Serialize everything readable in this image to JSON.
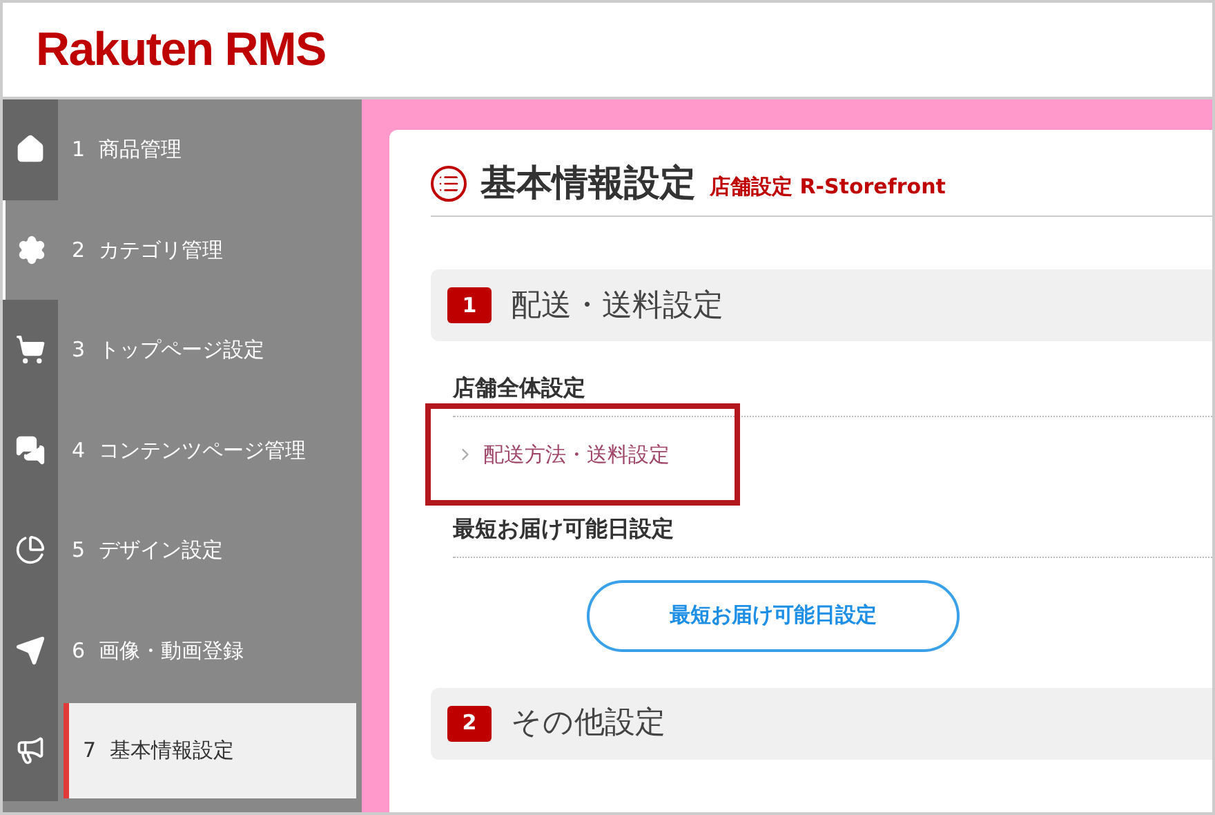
{
  "header": {
    "logo": "Rakuten RMS"
  },
  "sidebar": {
    "items": [
      {
        "kind": "home",
        "number": "1",
        "label": "商品管理",
        "selected": false,
        "hovered": false
      },
      {
        "kind": "gear",
        "number": "2",
        "label": "カテゴリ管理",
        "selected": false,
        "hovered": true
      },
      {
        "kind": "cart",
        "number": "3",
        "label": "トップページ設定",
        "selected": false,
        "hovered": false
      },
      {
        "kind": "chat",
        "number": "4",
        "label": "コンテンツページ管理",
        "selected": false,
        "hovered": false
      },
      {
        "kind": "pie",
        "number": "5",
        "label": "デザイン設定",
        "selected": false,
        "hovered": false
      },
      {
        "kind": "send",
        "number": "6",
        "label": "画像・動画登録",
        "selected": false,
        "hovered": false
      },
      {
        "kind": "megaphone",
        "number": "7",
        "label": "基本情報設定",
        "selected": true,
        "hovered": false
      }
    ]
  },
  "page": {
    "title": "基本情報設定",
    "subtitle": "店舗設定 R-Storefront"
  },
  "sections": [
    {
      "number": "1",
      "title": "配送・送料設定",
      "groups": [
        {
          "heading": "店舗全体設定",
          "link": "配送方法・送料設定",
          "highlighted": true
        },
        {
          "heading": "最短お届け可能日設定",
          "button": "最短お届け可能日設定"
        }
      ]
    },
    {
      "number": "2",
      "title": "その他設定"
    }
  ]
}
